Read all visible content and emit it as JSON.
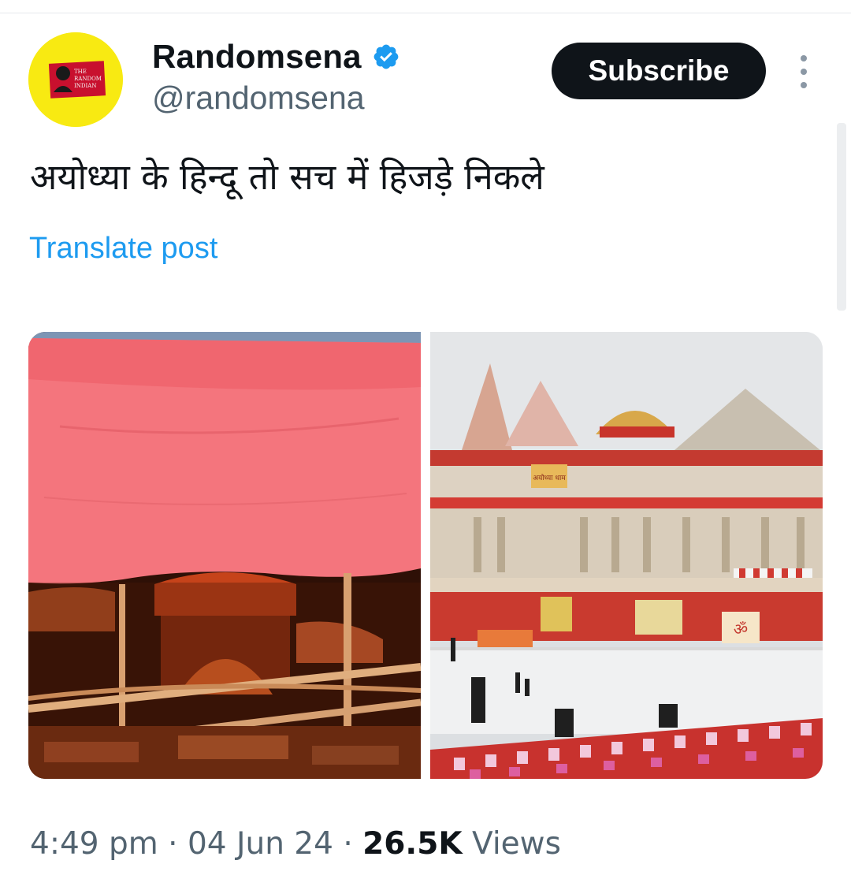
{
  "author": {
    "display_name": "Randomsena",
    "handle": "@randomsena",
    "avatar_text": [
      "THE",
      "RANDOM",
      "INDIAN"
    ],
    "avatar_bg": "#f8ea12",
    "verified_icon": "verified-badge-icon",
    "verified_color": "#1d9bf0"
  },
  "actions": {
    "subscribe_label": "Subscribe",
    "more_icon": "more-vertical-icon"
  },
  "post": {
    "text": "अयोध्या के हिन्दू तो सच में हिजड़े निकले",
    "translate_label": "Translate post",
    "images": [
      {
        "icon": "tent-shrine-photo"
      },
      {
        "icon": "temple-photo",
        "signs": [
          "अयोध्या धाम",
          "ॐ"
        ]
      }
    ]
  },
  "meta": {
    "time": "4:49 pm",
    "separator": "·",
    "date": "04 Jun 24",
    "views_count": "26.5K",
    "views_label": "Views"
  },
  "colors": {
    "text_primary": "#0f1419",
    "text_secondary": "#536471",
    "link": "#1d9bf0",
    "button_bg": "#0f1419"
  }
}
